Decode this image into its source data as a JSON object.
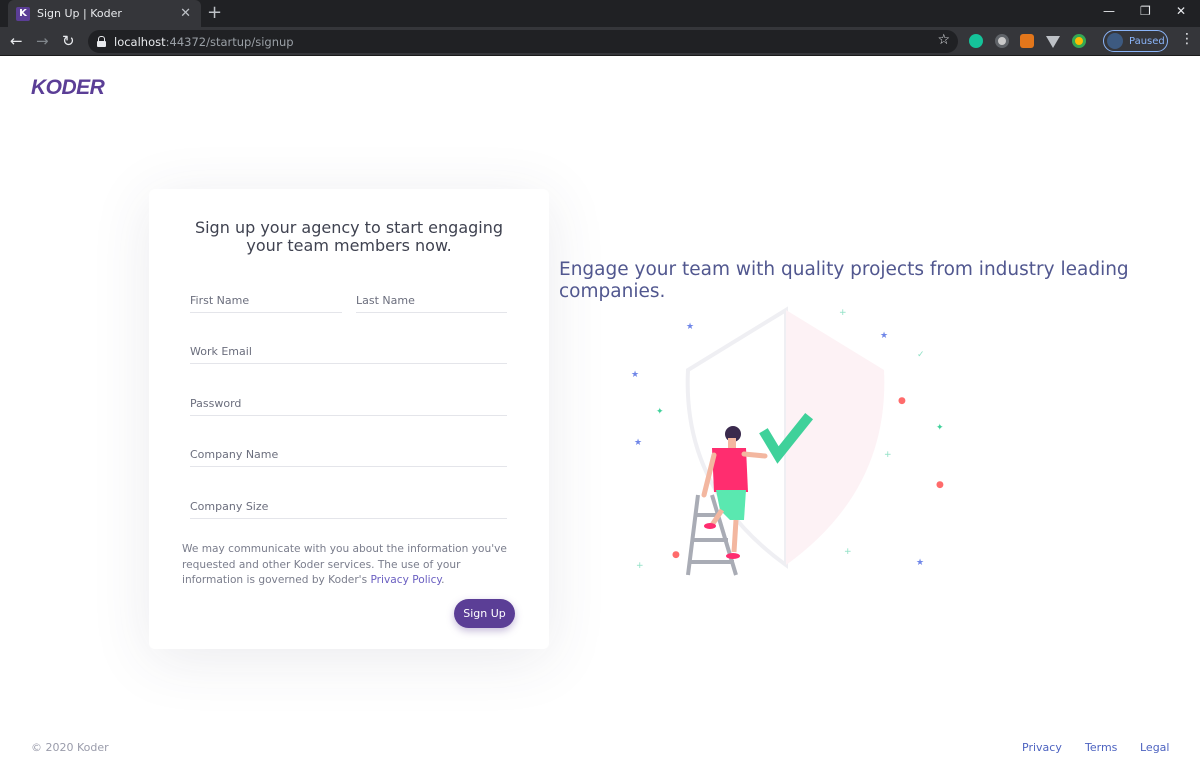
{
  "browser": {
    "tab_title": "Sign Up | Koder",
    "tab_favicon_letter": "K",
    "url_host": "localhost",
    "url_rest": ":44372/startup/signup",
    "profile_label": "Paused"
  },
  "brand": {
    "logo_text": "KODER",
    "accent_color": "#5b3e96"
  },
  "form": {
    "title": "Sign up your agency to start engaging your team members now.",
    "first_name_placeholder": "First Name",
    "last_name_placeholder": "Last Name",
    "work_email_placeholder": "Work Email",
    "password_placeholder": "Password",
    "company_name_placeholder": "Company Name",
    "company_size_placeholder": "Company Size",
    "disclaimer_prefix": "We may communicate with you about the information you've requested and other Koder services. The use of your information is governed by Koder's ",
    "privacy_policy_link": "Privacy Policy",
    "disclaimer_suffix": ".",
    "submit_label": "Sign Up"
  },
  "hero": {
    "tagline": "Engage your team with quality projects from industry leading companies."
  },
  "footer": {
    "copyright": "© 2020 Koder",
    "links": [
      "Privacy",
      "Terms",
      "Legal"
    ]
  }
}
